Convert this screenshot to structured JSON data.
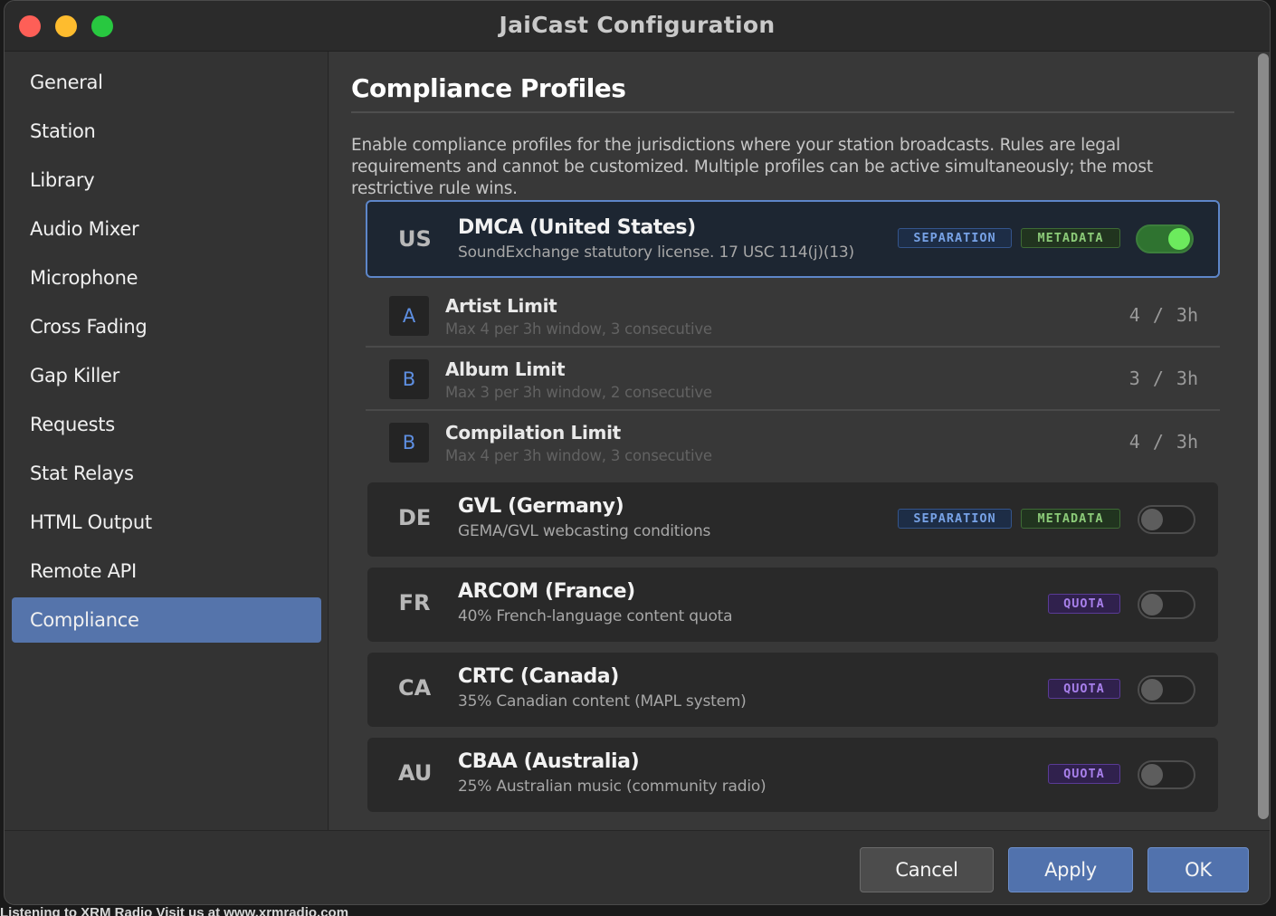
{
  "window": {
    "title": "JaiCast Configuration"
  },
  "background_text": "Listening to XRM Radio Visit us at www.xrmradio.com",
  "sidebar": {
    "items": [
      {
        "label": "General"
      },
      {
        "label": "Station"
      },
      {
        "label": "Library"
      },
      {
        "label": "Audio Mixer"
      },
      {
        "label": "Microphone"
      },
      {
        "label": "Cross Fading"
      },
      {
        "label": "Gap Killer"
      },
      {
        "label": "Requests"
      },
      {
        "label": "Stat Relays"
      },
      {
        "label": "HTML Output"
      },
      {
        "label": "Remote API"
      },
      {
        "label": "Compliance",
        "selected": true
      }
    ]
  },
  "main": {
    "title": "Compliance Profiles",
    "description": "Enable compliance profiles for the jurisdictions where your station broadcasts. Rules are legal requirements and cannot be customized. Multiple profiles can be active simultaneously; the most restrictive rule wins.",
    "profiles": [
      {
        "code": "US",
        "name": "DMCA (United States)",
        "description": "SoundExchange statutory license. 17 USC 114(j)(13)",
        "badges": [
          "SEPARATION",
          "METADATA"
        ],
        "enabled": true,
        "rules": [
          {
            "letter": "A",
            "name": "Artist Limit",
            "description": "Max 4 per 3h window, 3 consecutive",
            "value": "4 / 3h"
          },
          {
            "letter": "B",
            "name": "Album Limit",
            "description": "Max 3 per 3h window, 2 consecutive",
            "value": "3 / 3h"
          },
          {
            "letter": "B",
            "name": "Compilation Limit",
            "description": "Max 4 per 3h window, 3 consecutive",
            "value": "4 / 3h"
          }
        ]
      },
      {
        "code": "DE",
        "name": "GVL (Germany)",
        "description": "GEMA/GVL webcasting conditions",
        "badges": [
          "SEPARATION",
          "METADATA"
        ],
        "enabled": false
      },
      {
        "code": "FR",
        "name": "ARCOM (France)",
        "description": "40% French-language content quota",
        "badges": [
          "QUOTA"
        ],
        "enabled": false
      },
      {
        "code": "CA",
        "name": "CRTC (Canada)",
        "description": "35% Canadian content (MAPL system)",
        "badges": [
          "QUOTA"
        ],
        "enabled": false
      },
      {
        "code": "AU",
        "name": "CBAA (Australia)",
        "description": "25% Australian music (community radio)",
        "badges": [
          "QUOTA"
        ],
        "enabled": false
      }
    ]
  },
  "footer": {
    "cancel_label": "Cancel",
    "apply_label": "Apply",
    "ok_label": "OK"
  },
  "colors": {
    "accent": "#5574ab",
    "toggle_on": "#6ceb5d",
    "badge_separation": "#77a2e6",
    "badge_metadata": "#8bca78",
    "badge_quota": "#a77fea"
  }
}
